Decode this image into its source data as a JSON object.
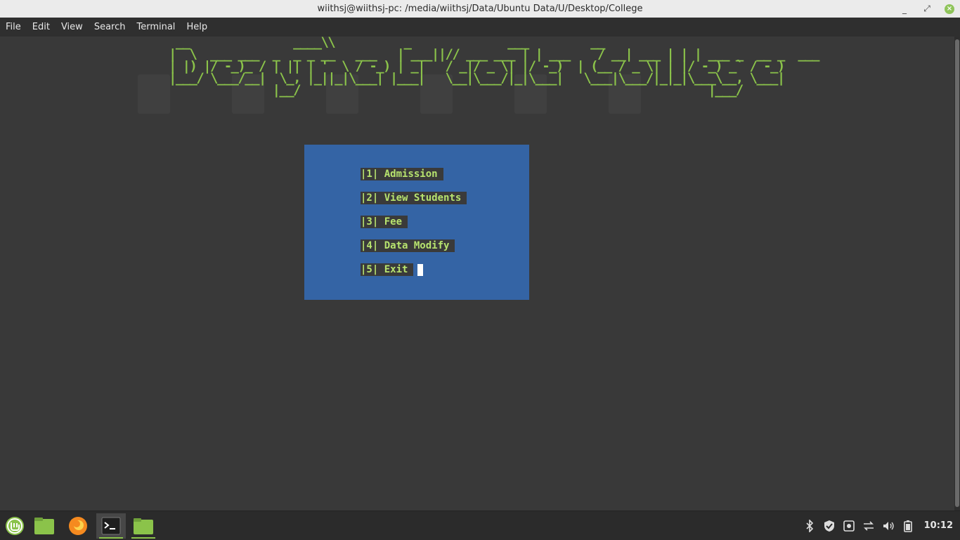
{
  "window": {
    "title": "wiithsj@wiithsj-pc: /media/wiithsj/Data/Ubuntu Data/U/Desktop/College",
    "controls": {
      "minimize": "_",
      "maximize": "⤢",
      "close": "×"
    }
  },
  "menubar": {
    "items": [
      "File",
      "Edit",
      "View",
      "Search",
      "Terminal",
      "Help"
    ]
  },
  "terminal": {
    "banner_lines": [
      " __               ____\\\\          _              ___         __                 ",
      "|  \\  ___ ___  _  _ _ __   ___   | ___||// ___ ___ | | ___    / __| ___ | | | ___ _  __ _  ___ ",
      "| |) |/ -_)_ / | || | '  \\ / -_) | _|   / _|/ _ \\| |/ -_)  | (__ / _ \\| | |/ -_) _` / -_)",
      "|___/ \\___/__|  \\_, |_||_|\\___| |___|   \\__|\\___/|_|\\___|   \\___|\\___/|_|_|\\___\\__, \\___|",
      "               |__/                                                           |___/      "
    ],
    "menu_options": [
      "|1| Admission",
      "|2| View Students",
      "|3| Fee",
      "|4| Data Modify",
      "|5| Exit"
    ],
    "colors": {
      "background": "#393939",
      "menu_box": "#3464a5",
      "option_bg": "#3a3a3a",
      "option_text": "#b7e36e",
      "banner": "#8bc34a"
    }
  },
  "taskbar": {
    "apps": [
      {
        "name": "mint-menu-icon"
      },
      {
        "name": "files-icon"
      },
      {
        "name": "firefox-icon"
      },
      {
        "name": "terminal-icon",
        "active": true
      },
      {
        "name": "folder-icon"
      }
    ],
    "tray_icons": [
      "bluetooth-icon",
      "shield-icon",
      "screenshot-icon",
      "network-icon",
      "volume-icon",
      "battery-icon"
    ],
    "clock": "10:12"
  }
}
